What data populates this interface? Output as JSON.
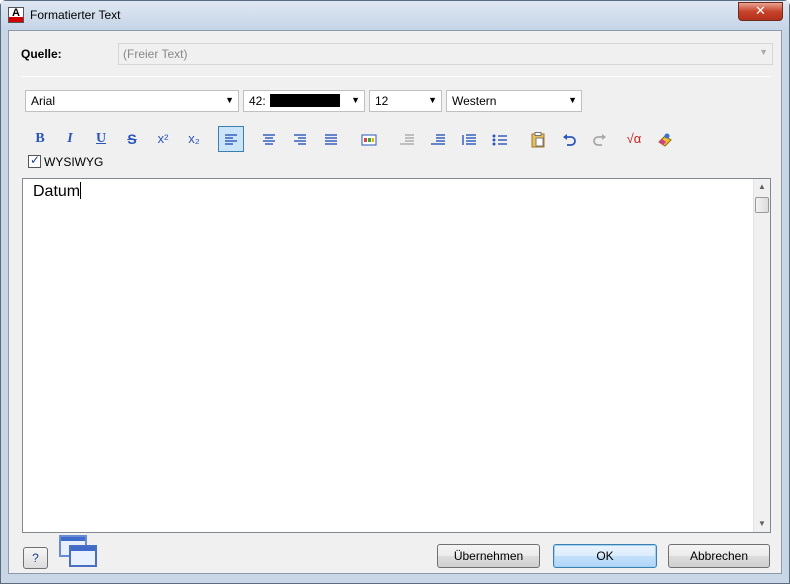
{
  "window": {
    "title": "Formatierter Text",
    "close_label": "✕"
  },
  "quelle": {
    "label": "Quelle:",
    "value": "(Freier Text)"
  },
  "format": {
    "font": "Arial",
    "color_label": "42:",
    "size": "12",
    "charset": "Western"
  },
  "toolbar": {
    "bold": "B",
    "italic": "I",
    "underline": "U",
    "strike": "S",
    "superscript": "x²",
    "subscript": "x₂",
    "symbol": "√α"
  },
  "wysiwyg": {
    "label": "WYSIWYG",
    "checked": true
  },
  "editor": {
    "content": "Datum"
  },
  "buttons": {
    "apply": "Übernehmen",
    "ok": "OK",
    "cancel": "Abbrechen",
    "help": "?"
  },
  "colors": {
    "accent": "#2b55b8",
    "close": "#c7422b",
    "selection": "#cce4f7"
  }
}
